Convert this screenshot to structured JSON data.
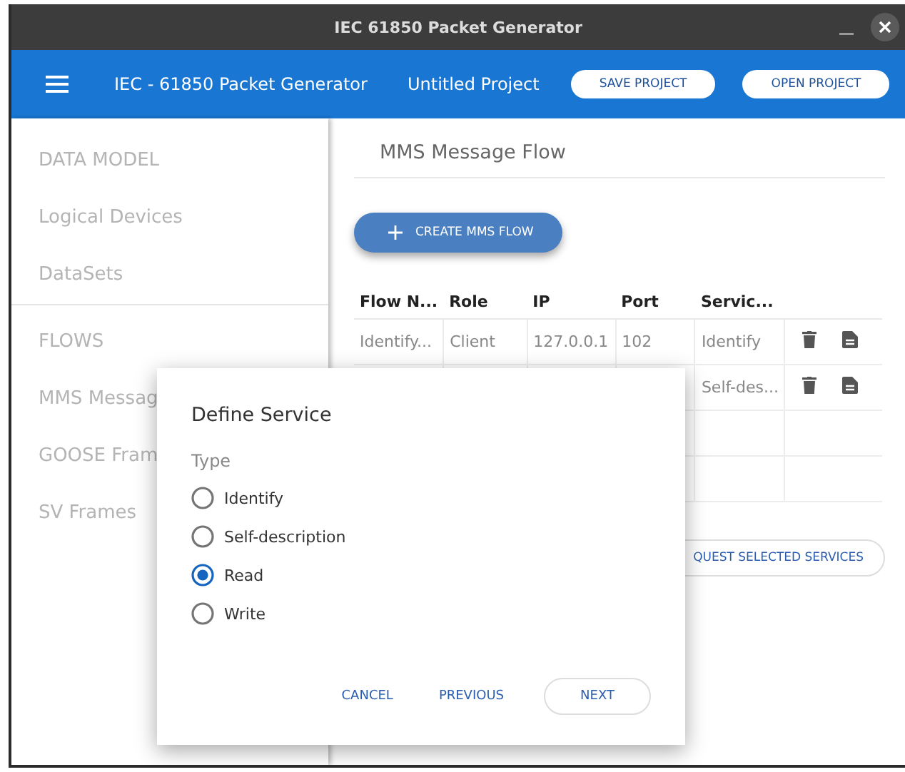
{
  "window": {
    "title": "IEC 61850 Packet Generator"
  },
  "app_bar": {
    "title": "IEC - 61850 Packet Generator",
    "project": "Untitled Project",
    "buttons": [
      "SAVE PROJECT",
      "OPEN PROJECT"
    ]
  },
  "sidebar": {
    "sections": [
      {
        "items": [
          "DATA MODEL",
          "Logical Devices",
          "DataSets"
        ]
      },
      {
        "items": [
          "FLOWS",
          "MMS Messag",
          "GOOSE Fram",
          "SV Frames"
        ]
      }
    ]
  },
  "main": {
    "heading": "MMS Message Flow",
    "create_button": "CREATE MMS FLOW",
    "table": {
      "columns": [
        "Flow N...",
        "Role",
        "IP",
        "Port",
        "Servic..."
      ],
      "rows": [
        {
          "cells": [
            "Identify...",
            "Client",
            "127.0.0.1",
            "102",
            "Identify"
          ],
          "actions": true
        },
        {
          "cells": [
            null,
            null,
            null,
            null,
            "Self-des..."
          ],
          "actions": true
        },
        {
          "cells": [
            null,
            null,
            null,
            null,
            null
          ],
          "actions": false
        },
        {
          "cells": [
            null,
            null,
            null,
            null,
            null
          ],
          "actions": false
        }
      ]
    },
    "request_button": "QUEST SELECTED SERVICES"
  },
  "dialog": {
    "title": "Define Service",
    "label": "Type",
    "options": [
      {
        "label": "Identify",
        "selected": false
      },
      {
        "label": "Self-description",
        "selected": false
      },
      {
        "label": "Read",
        "selected": true
      },
      {
        "label": "Write",
        "selected": false
      }
    ],
    "buttons": [
      {
        "label": "CANCEL",
        "kind": "text"
      },
      {
        "label": "PREVIOUS",
        "kind": "text"
      },
      {
        "label": "NEXT",
        "kind": "outlined"
      }
    ]
  }
}
